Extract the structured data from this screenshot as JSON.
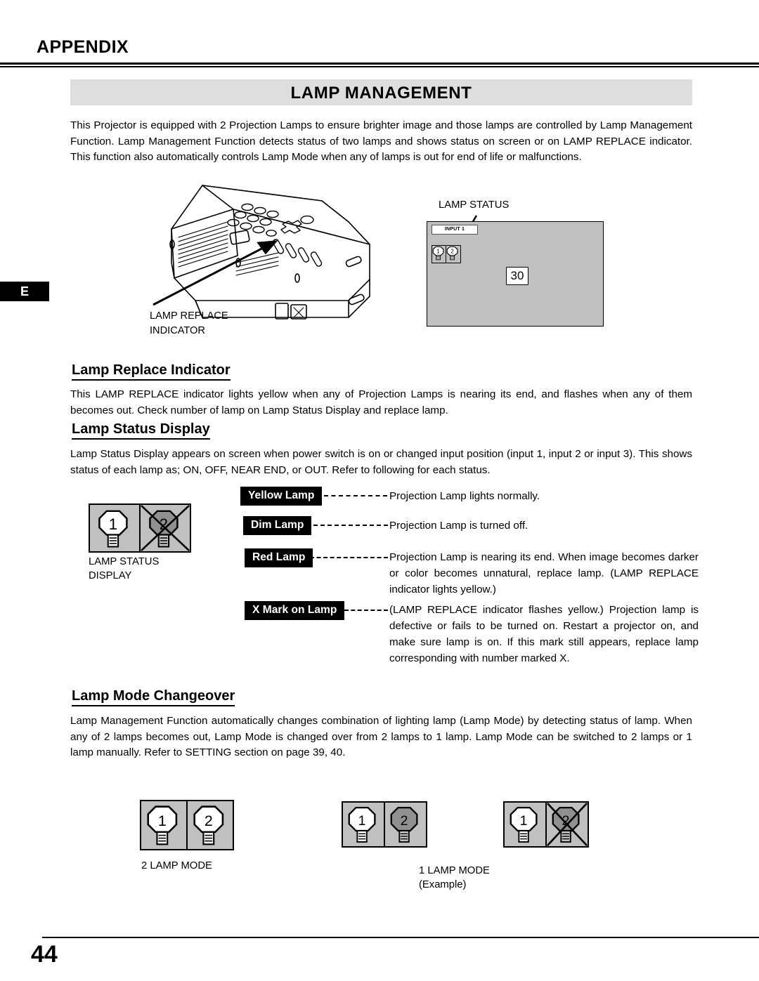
{
  "header": {
    "appendix_label": "APPENDIX",
    "title": "LAMP MANAGEMENT",
    "language_tab": "E"
  },
  "intro": {
    "paragraph": "This Projector is equipped with 2 Projection Lamps to ensure brighter image and those lamps are controlled by Lamp Management Function.  Lamp Management Function detects status of two lamps and shows status on screen or on LAMP REPLACE indicator.  This function also automatically controls Lamp Mode when any of lamps is out for end of life or malfunctions."
  },
  "projector_figure": {
    "callout": "LAMP REPLACE\nINDICATOR"
  },
  "screen_figure": {
    "callout": "LAMP STATUS",
    "input_label": "INPUT 1",
    "countdown": "30",
    "lamp1": "1",
    "lamp2": "2"
  },
  "sections": [
    {
      "heading": "Lamp Replace Indicator",
      "paragraph": "This LAMP REPLACE indicator lights yellow when any of Projection Lamps is nearing its end, and flashes when any of them becomes out.  Check number of lamp on Lamp Status Display and replace lamp."
    },
    {
      "heading": "Lamp Status Display",
      "paragraph": "Lamp Status Display appears on screen when power switch is on or changed input position (input 1, input 2 or input 3). This shows status of each lamp as; ON, OFF, NEAR END, or OUT.  Refer to following for each status."
    },
    {
      "heading": "Lamp Mode Changeover",
      "paragraph": "Lamp Management Function automatically changes combination of lighting lamp (Lamp Mode) by detecting status of lamp. When any of 2 lamps becomes out, Lamp Mode is changed over from 2 lamps to 1 lamp. Lamp Mode can be switched to 2 lamps or 1 lamp manually.  Refer to SETTING section on page 39, 40."
    }
  ],
  "status_display_figure": {
    "caption": "LAMP STATUS\nDISPLAY",
    "lamp1": "1",
    "lamp2": "2"
  },
  "legend": [
    {
      "chip": "Yellow Lamp",
      "text": "Projection Lamp lights normally."
    },
    {
      "chip": "Dim Lamp",
      "text": "Projection Lamp is turned off."
    },
    {
      "chip": "Red Lamp",
      "text": "Projection Lamp is nearing its end.  When image becomes darker or color becomes unnatural, replace lamp. (LAMP REPLACE indicator lights yellow.)"
    },
    {
      "chip": "X Mark on Lamp",
      "text": "(LAMP REPLACE indicator flashes yellow.) Projection lamp is defective or fails to be turned on. Restart a projector on, and make sure lamp is on. If this mark still appears, replace lamp corresponding with number marked X."
    }
  ],
  "lamp_modes": [
    {
      "name": "two-lamp-mode",
      "caption": "2 LAMP MODE",
      "lamp1": "1",
      "lamp2": "2"
    },
    {
      "name": "one-lamp-mode-dim",
      "caption": "1 LAMP MODE\n(Example)",
      "lamp1": "1",
      "lamp2": "2"
    },
    {
      "name": "one-lamp-mode-x",
      "caption": "",
      "lamp1": "1",
      "lamp2": "2"
    }
  ],
  "footer": {
    "page_number": "44"
  },
  "colors": {
    "title_band": "#dedede",
    "lamp_cell_bg": "#c0c0c0",
    "bulb_on": "#ffffff",
    "bulb_dim": "#909090",
    "ink": "#000000"
  }
}
